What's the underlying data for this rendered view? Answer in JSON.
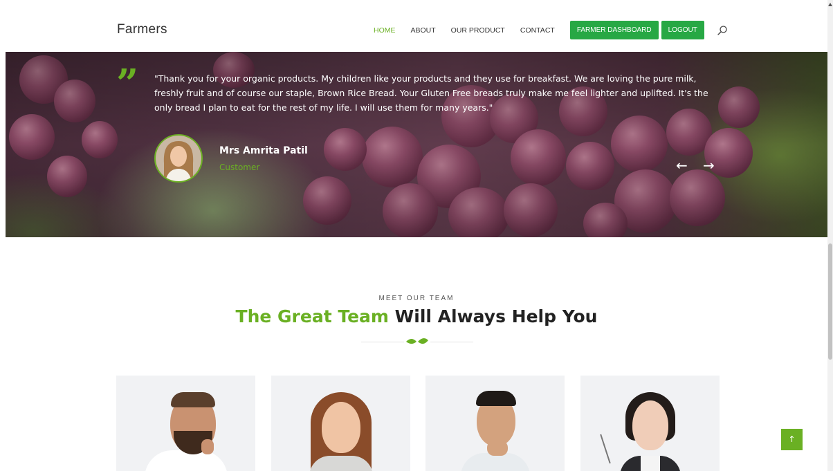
{
  "brand": {
    "name": "Farmers"
  },
  "nav": {
    "links": [
      "HOME",
      "ABOUT",
      "OUR PRODUCT",
      "CONTACT"
    ],
    "active": "HOME",
    "dashboard_button": "FARMER DASHBOARD",
    "logout_button": "LOGOUT",
    "search_icon": "search-icon"
  },
  "testimonial": {
    "quote": "\"Thank you for your organic products. My children like your products and they use for breakfast. We are loving the pure milk, freshly fruit and of course our staple, Brown Rice Bread. Your Gluten Free breads truly make me feel lighter and uplifted. It's the only bread I plan to eat for the rest of my life. I will use them for many years.\"",
    "author_name": "Mrs Amrita Patil",
    "author_role": "Customer",
    "prev_arrow": "←",
    "next_arrow": "→"
  },
  "team": {
    "kicker": "MEET OUR TEAM",
    "title_highlight": "The Great Team",
    "title_rest": " Will Always Help You",
    "divider_icon": "leaf-icon"
  },
  "back_to_top": {
    "label": "↑"
  },
  "colors": {
    "accent_green": "#6ab023",
    "button_green": "#27a844",
    "card_bg": "#f1f2f4"
  }
}
